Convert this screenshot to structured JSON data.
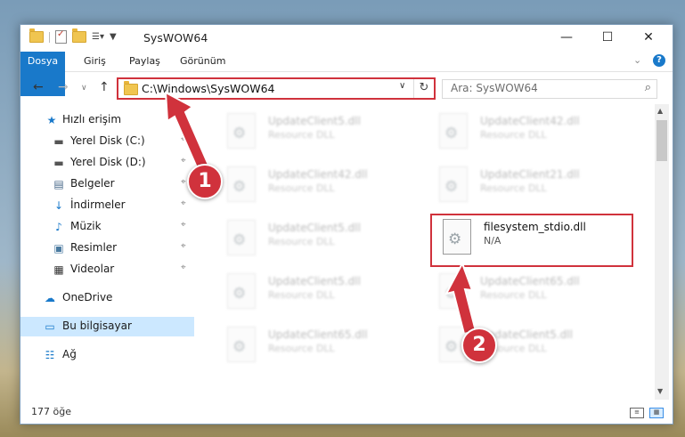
{
  "window": {
    "title": "SysWOW64",
    "minimize": "—",
    "maximize": "☐",
    "close": "✕"
  },
  "ribbon": {
    "tabs": [
      "Dosya",
      "Giriş",
      "Paylaş",
      "Görünüm"
    ],
    "collapse": "⌄",
    "help": "?"
  },
  "address": {
    "path": "C:\\Windows\\SysWOW64",
    "dropdown": "∨",
    "refresh": "↻"
  },
  "search": {
    "placeholder": "Ara: SysWOW64",
    "icon": "⌕"
  },
  "nav_buttons": {
    "back": "←",
    "forward": "→",
    "recent": "∨",
    "up": "↑"
  },
  "sidebar": {
    "items": [
      {
        "label": "Hızlı erişim",
        "icon": "★",
        "pinned": false
      },
      {
        "label": "Yerel Disk (C:)",
        "icon": "▬",
        "pinned": true
      },
      {
        "label": "Yerel Disk (D:)",
        "icon": "▬",
        "pinned": true
      },
      {
        "label": "Belgeler",
        "icon": "▤",
        "pinned": true
      },
      {
        "label": "İndirmeler",
        "icon": "↓",
        "pinned": true
      },
      {
        "label": "Müzik",
        "icon": "♪",
        "pinned": true
      },
      {
        "label": "Resimler",
        "icon": "▣",
        "pinned": true
      },
      {
        "label": "Videolar",
        "icon": "▦",
        "pinned": true
      },
      {
        "label": "OneDrive",
        "icon": "☁",
        "pinned": false
      },
      {
        "label": "Bu bilgisayar",
        "icon": "▭",
        "pinned": false
      },
      {
        "label": "Ağ",
        "icon": "☷",
        "pinned": false
      }
    ],
    "pin_glyph": "⌖"
  },
  "files": [
    {
      "name": "UpdateClient5.dll",
      "type": "Resource DLL"
    },
    {
      "name": "UpdateClient42.dll",
      "type": "Resource DLL"
    },
    {
      "name": "UpdateClient42.dll",
      "type": "Resource DLL"
    },
    {
      "name": "UpdateClient21.dll",
      "type": "Resource DLL"
    },
    {
      "name": "UpdateClient5.dll",
      "type": "Resource DLL"
    },
    {
      "name": "filesystem_stdio.dll",
      "type": "N/A"
    },
    {
      "name": "UpdateClient5.dll",
      "type": "Resource DLL"
    },
    {
      "name": "UpdateClient65.dll",
      "type": "Resource DLL"
    },
    {
      "name": "UpdateClient65.dll",
      "type": "Resource DLL"
    },
    {
      "name": "UpdateClient5.dll",
      "type": "Resource DLL"
    }
  ],
  "status": {
    "count": "177 öğe"
  },
  "annotations": {
    "step1": "1",
    "step2": "2",
    "color": "#d0323c"
  }
}
